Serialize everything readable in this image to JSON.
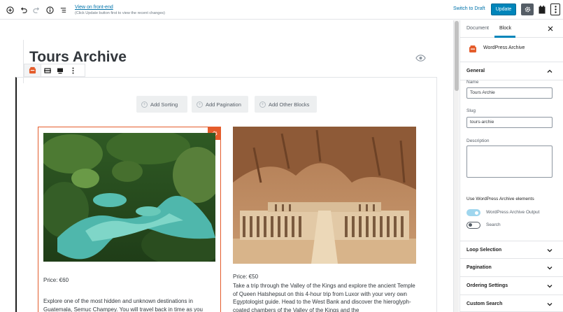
{
  "topbar": {
    "view_link": "View on front-end",
    "view_note": "(Click Update button first to view the recent changes)",
    "switch_draft": "Switch to Draft",
    "update": "Update"
  },
  "editor": {
    "title": "Tours Archive",
    "buttons": {
      "add_sorting": "Add Sorting",
      "add_pagination": "Add Pagination",
      "add_other_blocks": "Add Other Blocks"
    },
    "cards": [
      {
        "price": "Price: €60",
        "description": "Explore one of the most hidden and unknown destinations in Guatemala, Semuc Champey. You will travel back in time as you"
      },
      {
        "price": "Price: €50",
        "description": "Take a trip through the Valley of the Kings and explore the ancient Temple of Queen Hatshepsut on this 4-hour trip from Luxor with your very own Egyptologist guide. Head to the West Bank and discover the hieroglyph-coated chambers of the Valley of the Kings and the"
      }
    ]
  },
  "sidebar": {
    "tabs": [
      "Document",
      "Block"
    ],
    "block_name": "WordPress Archive",
    "general": {
      "title": "General",
      "name_label": "Name",
      "name_value": "Tours Archie",
      "slug_label": "Slug",
      "slug_value": "tours-archie",
      "description_label": "Description",
      "elements_heading": "Use WordPress Archive elements",
      "toggles": [
        {
          "label": "WordPress Archive Output",
          "on": true
        },
        {
          "label": "Search",
          "on": false
        }
      ]
    },
    "panels": [
      "Loop Selection",
      "Pagination",
      "Ordering Settings",
      "Custom Search"
    ]
  },
  "colors": {
    "accent": "#0085ba",
    "brand_orange": "#e45c2b"
  }
}
